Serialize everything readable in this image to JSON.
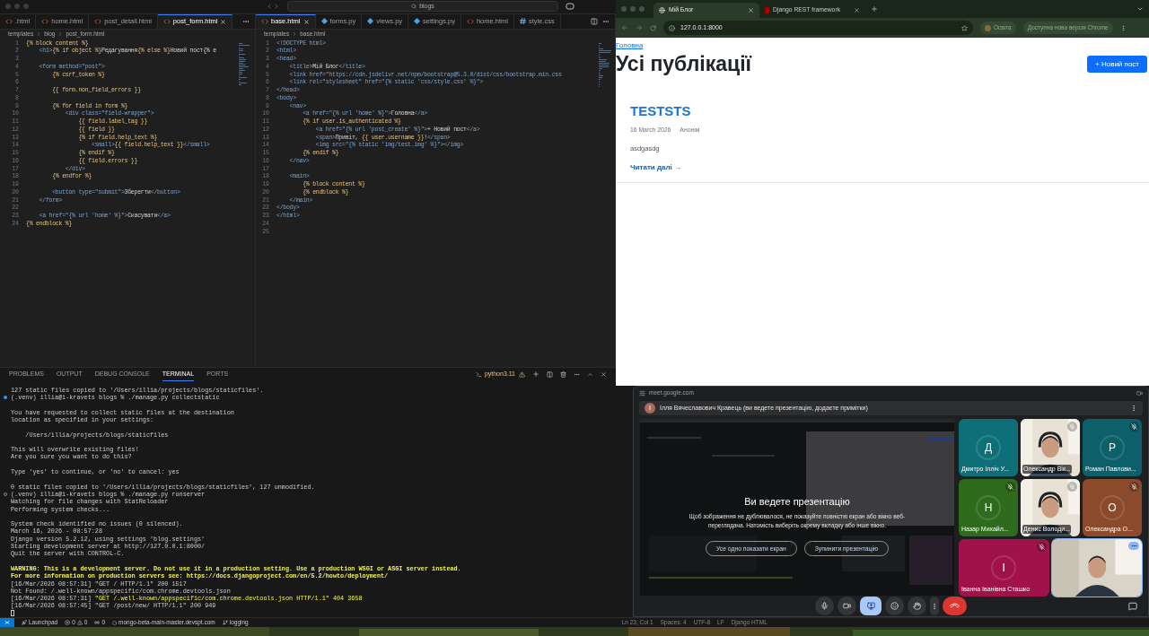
{
  "vscode": {
    "search": "blogs",
    "editors": [
      {
        "tabs": [
          {
            "label": ".html",
            "kind": "html",
            "selected": false
          },
          {
            "label": "home.html",
            "kind": "html",
            "selected": false
          },
          {
            "label": "post_detail.html",
            "kind": "html",
            "selected": false
          },
          {
            "label": "post_form.html",
            "kind": "html",
            "selected": true
          }
        ],
        "breadcrumb": [
          "templates",
          "blog",
          "post_form.html"
        ],
        "lines": [
          {
            "n": "1",
            "code": "{% block content %}"
          },
          {
            "n": "2",
            "code": "    <h1>{% if object %}Редагування{% else %}Новий пост{% e"
          },
          {
            "n": "3"
          },
          {
            "n": "4",
            "code": "    <form method=\"post\">"
          },
          {
            "n": "5",
            "code": "        {% csrf_token %}"
          },
          {
            "n": "6"
          },
          {
            "n": "7",
            "code": "        {{ form.non_field_errors }}"
          },
          {
            "n": "8"
          },
          {
            "n": "9",
            "code": "        {% for field in form %}"
          },
          {
            "n": "10",
            "code": "            <div class=\"field-wrapper\">"
          },
          {
            "n": "11",
            "code": "                {{ field.label_tag }}"
          },
          {
            "n": "12",
            "code": "                {{ field }}"
          },
          {
            "n": "13",
            "code": "                {% if field.help_text %}"
          },
          {
            "n": "14",
            "code": "                    <small>{{ field.help_text }}</small>"
          },
          {
            "n": "15",
            "code": "                {% endif %}"
          },
          {
            "n": "16",
            "code": "                {{ field.errors }}"
          },
          {
            "n": "17",
            "code": "            </div>"
          },
          {
            "n": "18",
            "code": "        {% endfor %}"
          },
          {
            "n": "19"
          },
          {
            "n": "20",
            "code": "        <button type=\"submit\">Зберегти</button>"
          },
          {
            "n": "21",
            "code": "    </form>"
          },
          {
            "n": "22"
          },
          {
            "n": "23",
            "code": "    <a href=\"{% url 'home' %}\">Скасувати</a>"
          },
          {
            "n": "24",
            "code": "{% endblock %}"
          }
        ]
      },
      {
        "tabs": [
          {
            "label": "base.html",
            "kind": "html",
            "selected": true
          },
          {
            "label": "forms.py",
            "kind": "py",
            "selected": false
          },
          {
            "label": "views.py",
            "kind": "py",
            "selected": false
          },
          {
            "label": "settings.py",
            "kind": "py",
            "selected": false
          },
          {
            "label": "home.html",
            "kind": "html",
            "selected": false
          },
          {
            "label": "style.css",
            "kind": "css",
            "selected": false
          }
        ],
        "breadcrumb": [
          "templates",
          "base.html"
        ],
        "lines": [
          {
            "n": "1",
            "code": "<!DOCTYPE html>"
          },
          {
            "n": "2",
            "code": "<html>"
          },
          {
            "n": "3",
            "code": "<head>"
          },
          {
            "n": "4",
            "code": "    <title>Мій Блог</title>"
          },
          {
            "n": "5",
            "code": "    <link href=\"https://cdn.jsdelivr.net/npm/bootstrap@5.3.0/dist/css/bootstrap.min.css"
          },
          {
            "n": "6",
            "code": "    <link rel=\"stylesheet\" href=\"{% static 'css/style.css' %}\">"
          },
          {
            "n": "7",
            "code": "</head>"
          },
          {
            "n": "8",
            "code": "<body>"
          },
          {
            "n": "9",
            "code": "    <nav>"
          },
          {
            "n": "10",
            "code": "        <a href=\"{% url 'home' %}\">Головна</a>"
          },
          {
            "n": "11",
            "code": "        {% if user.is_authenticated %}"
          },
          {
            "n": "12",
            "code": "            <a href=\"{% url 'post_create' %}\">+ Новий пост</a>"
          },
          {
            "n": "13",
            "code": "            <span>Привіт, {{ user.username }}!</span>"
          },
          {
            "n": "14",
            "code": "            <img src=\"{% static 'img/test.img' %}\"></img>"
          },
          {
            "n": "15",
            "code": "        {% endif %}"
          },
          {
            "n": "16",
            "code": "    </nav>"
          },
          {
            "n": "17"
          },
          {
            "n": "18",
            "code": "    <main>"
          },
          {
            "n": "19",
            "code": "        {% block content %}"
          },
          {
            "n": "20",
            "code": "        {% endblock %}"
          },
          {
            "n": "21",
            "code": "    </main>"
          },
          {
            "n": "22",
            "code": "</body>"
          },
          {
            "n": "23",
            "code": "</html>"
          },
          {
            "n": "24"
          },
          {
            "n": "25"
          }
        ]
      }
    ],
    "panel": {
      "tabs": [
        {
          "label": "PROBLEMS",
          "selected": false
        },
        {
          "label": "OUTPUT",
          "selected": false
        },
        {
          "label": "DEBUG CONSOLE",
          "selected": false
        },
        {
          "label": "TERMINAL",
          "selected": true
        },
        {
          "label": "PORTS",
          "selected": false
        }
      ],
      "shell": "python3.11",
      "lines": [
        {
          "kind": "plain",
          "text": "127 static files copied to '/Users/illia/projects/blogs/staticfiles'."
        },
        {
          "kind": "prompt_done",
          "text": "(.venv) illia@i-kravets blogs % ./manage.py collectstatic"
        },
        {
          "kind": "blank"
        },
        {
          "kind": "plain",
          "text": "You have requested to collect static files at the destination"
        },
        {
          "kind": "plain",
          "text": "location as specified in your settings:"
        },
        {
          "kind": "blank"
        },
        {
          "kind": "plain",
          "text": "    /Users/illia/projects/blogs/staticfiles"
        },
        {
          "kind": "blank"
        },
        {
          "kind": "plain",
          "text": "This will overwrite existing files!"
        },
        {
          "kind": "plain",
          "text": "Are you sure you want to do this?"
        },
        {
          "kind": "blank"
        },
        {
          "kind": "plain",
          "text": "Type 'yes' to continue, or 'no' to cancel: yes"
        },
        {
          "kind": "blank"
        },
        {
          "kind": "plain",
          "text": "0 static files copied to '/Users/illia/projects/blogs/staticfiles', 127 unmodified."
        },
        {
          "kind": "prompt_running",
          "text": "(.venv) illia@i-kravets blogs % ./manage.py runserver"
        },
        {
          "kind": "plain",
          "text": "Watching for file changes with StatReloader"
        },
        {
          "kind": "plain",
          "text": "Performing system checks..."
        },
        {
          "kind": "blank"
        },
        {
          "kind": "plain",
          "text": "System check identified no issues (0 silenced)."
        },
        {
          "kind": "plain",
          "text": "March 16, 2026 - 08:57:28"
        },
        {
          "kind": "plain",
          "text": "Django version 5.2.12, using settings 'blog.settings'"
        },
        {
          "kind": "plain",
          "text": "Starting development server at http://127.0.0.1:8000/"
        },
        {
          "kind": "plain",
          "text": "Quit the server with CONTROL-C."
        },
        {
          "kind": "blank"
        },
        {
          "kind": "warning",
          "text": "WARNING: This is a development server. Do not use it in a production setting. Use a production WSGI or ASGI server instead."
        },
        {
          "kind": "warning",
          "text": "For more information on production servers see: https://docs.djangoproject.com/en/5.2/howto/deployment/"
        },
        {
          "kind": "plain",
          "text": "[16/Mar/2026 08:57:31] \"GET / HTTP/1.1\" 200 1517"
        },
        {
          "kind": "plain",
          "text": "Not Found: /.well-known/appspecific/com.chrome.devtools.json"
        },
        {
          "kind": "request_error",
          "time": "[16/Mar/2026 08:57:31]",
          "text": "\"GET /.well-known/appspecific/com.chrome.devtools.json HTTP/1.1\" 404 3658"
        },
        {
          "kind": "plain",
          "text": "[16/Mar/2026 08:57:45] \"GET /post/new/ HTTP/1.1\" 200 949"
        },
        {
          "kind": "cursor"
        }
      ]
    },
    "status_bar": {
      "launchpad": "Launchpad",
      "errors": "0",
      "warnings": "0",
      "ports": "0",
      "remote": "mongo-beta-main-master.devspt.com",
      "branch": "logging",
      "right": [
        "Ln 23, Col 1",
        "Spaces: 4",
        "UTF-8",
        "LF",
        "Django HTML"
      ]
    }
  },
  "browser": {
    "tabs": [
      {
        "title": "Мій Блог",
        "selected": true
      },
      {
        "title": "Django REST framework",
        "selected": false
      }
    ],
    "url": "127.0.0.1:8000",
    "profile": "Освіта",
    "update": "Доступна нова версія Chrome",
    "page": {
      "nav_link": "Головна",
      "heading": "Усі публікації",
      "new_post": "+ Новий пост",
      "posts": [
        {
          "title": "TESTSTS",
          "date": "16 March 2026",
          "author": "Анонім",
          "excerpt": "asdgasdg",
          "read_more": "Читати далі →"
        }
      ]
    }
  },
  "meet": {
    "url": "meet.google.com",
    "banner": {
      "initial": "І",
      "text": "Ілля Вячеславович Кравець (ви ведете презентацію, додаєте примітки)"
    },
    "presenting": true,
    "notice": {
      "title": "Ви ведете презентацію",
      "text": "Щоб зображення не дублювалося, не показуйте повністю екран або вікно веб-переглядача. Натомість виберіть окрему вкладку або інше вікно.",
      "buttons": [
        "Усе одно показати екран",
        "Зупинити презентацію"
      ]
    },
    "tiles": [
      {
        "kind": "avatar",
        "name": "Дмитро Ілліч У...",
        "initial": "Д",
        "color": "#0f6f78",
        "muted": false
      },
      {
        "kind": "video",
        "name": "Олександр Вік...",
        "muted": true
      },
      {
        "kind": "avatar",
        "name": "Роман Павлови...",
        "initial": "Р",
        "color": "#0d5f69",
        "muted": true
      },
      {
        "kind": "avatar",
        "name": "Назар Михайл...",
        "initial": "Н",
        "color": "#2f6b1c",
        "muted": true
      },
      {
        "kind": "video",
        "name": "Денис Володи...",
        "muted": true
      },
      {
        "kind": "avatar",
        "name": "Олександра О...",
        "initial": "О",
        "color": "#8b4a2b",
        "muted": true
      },
      {
        "kind": "avatar",
        "name": "Іванна Іванівна Сташко",
        "initial": "І",
        "color": "#a0124a",
        "muted": true
      },
      {
        "kind": "video",
        "self": true,
        "muted": false
      }
    ]
  }
}
